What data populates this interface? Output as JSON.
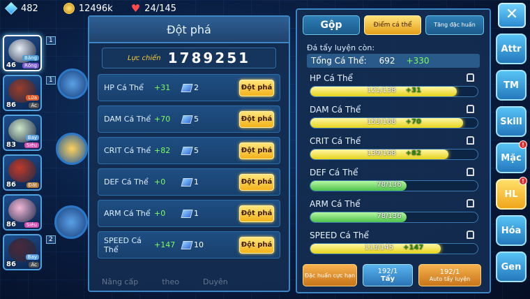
{
  "topbar": {
    "gems": "482",
    "gold": "12496k",
    "stamina": "24/145"
  },
  "team": [
    {
      "level": "46",
      "tags": [
        "Băng",
        "Rồng"
      ],
      "index": "1",
      "color": "#e8eef5",
      "t1": "#4a9bd4",
      "t2": "#7a5bd0"
    },
    {
      "level": "86",
      "tags": [
        "Lửa",
        "Ác"
      ],
      "index": "1",
      "color": "#9a3d2a",
      "t1": "#e05a2a",
      "t2": "#555"
    },
    {
      "level": "83",
      "tags": [
        "Bay",
        "Siêu"
      ],
      "index": "",
      "color": "#cfe8c8",
      "t1": "#5aa0e0",
      "t2": "#d050b0"
    },
    {
      "level": "86",
      "tags": [
        "Đất"
      ],
      "index": "",
      "color": "#c03a2a",
      "t1": "#b07a3a",
      "t2": ""
    },
    {
      "level": "86",
      "tags": [
        "Siêu"
      ],
      "index": "",
      "color": "#f5b8d8",
      "t1": "#d050b0",
      "t2": ""
    },
    {
      "level": "86",
      "tags": [
        "Bay",
        "Ác"
      ],
      "index": "2",
      "color": "#4a2a3a",
      "t1": "#5aa0e0",
      "t2": "#555"
    }
  ],
  "breakthrough": {
    "title": "Đột phá",
    "power_label": "Lực chiến",
    "power": "1789251",
    "button_label": "Đột phá",
    "rows": [
      {
        "name": "HP Cá Thể",
        "bonus": "+31",
        "count": "2"
      },
      {
        "name": "DAM Cá Thể",
        "bonus": "+70",
        "count": "5"
      },
      {
        "name": "CRIT Cá Thể",
        "bonus": "+82",
        "count": "5"
      },
      {
        "name": "DEF Cá Thể",
        "bonus": "+0",
        "count": "1"
      },
      {
        "name": "ARM Cá Thể",
        "bonus": "+0",
        "count": "1"
      },
      {
        "name": "SPEED Cá Thể",
        "bonus": "+147",
        "count": "10"
      }
    ],
    "bottom_tabs": [
      "Nâng cấp",
      "theo",
      "Duyên"
    ]
  },
  "training": {
    "tabs": [
      "Gộp",
      "Điểm cá thể",
      "Tăng đặc huấn"
    ],
    "remaining_label": "Đá tẩy luyện còn:",
    "total_label": "Tổng Cá Thể:",
    "total_value": "692",
    "total_bonus": "+330",
    "stats": [
      {
        "name": "HP Cá Thể",
        "value": "121/138",
        "bonus": "+31",
        "fill": 0.877,
        "style": "gold"
      },
      {
        "name": "DAM Cá Thể",
        "value": "153/168",
        "bonus": "+70",
        "fill": 0.911,
        "style": "gold"
      },
      {
        "name": "CRIT Cá Thể",
        "value": "139/168",
        "bonus": "+82",
        "fill": 0.827,
        "style": "gold"
      },
      {
        "name": "DEF Cá Thể",
        "value": "78/136",
        "bonus": "",
        "fill": 0.574,
        "style": "green"
      },
      {
        "name": "ARM Cá Thể",
        "value": "78/136",
        "bonus": "",
        "fill": 0.574,
        "style": "green"
      },
      {
        "name": "SPEED Cá Thể",
        "value": "113/145",
        "bonus": "+147",
        "fill": 0.779,
        "style": "gold"
      }
    ],
    "actions": [
      {
        "label": "Đặc huấn cực hạn",
        "count": ""
      },
      {
        "label": "Tẩy",
        "count": "192/1"
      },
      {
        "label": "Auto tẩy luyện",
        "count": "192/1"
      }
    ]
  },
  "nav": {
    "close": "✕",
    "items": [
      {
        "label": "Attr",
        "badge": ""
      },
      {
        "label": "TM",
        "badge": ""
      },
      {
        "label": "Skill",
        "badge": ""
      },
      {
        "label": "Mặc",
        "badge": "!"
      },
      {
        "label": "HL",
        "badge": "!"
      },
      {
        "label": "Hóa",
        "badge": ""
      },
      {
        "label": "Gen",
        "badge": ""
      }
    ]
  }
}
